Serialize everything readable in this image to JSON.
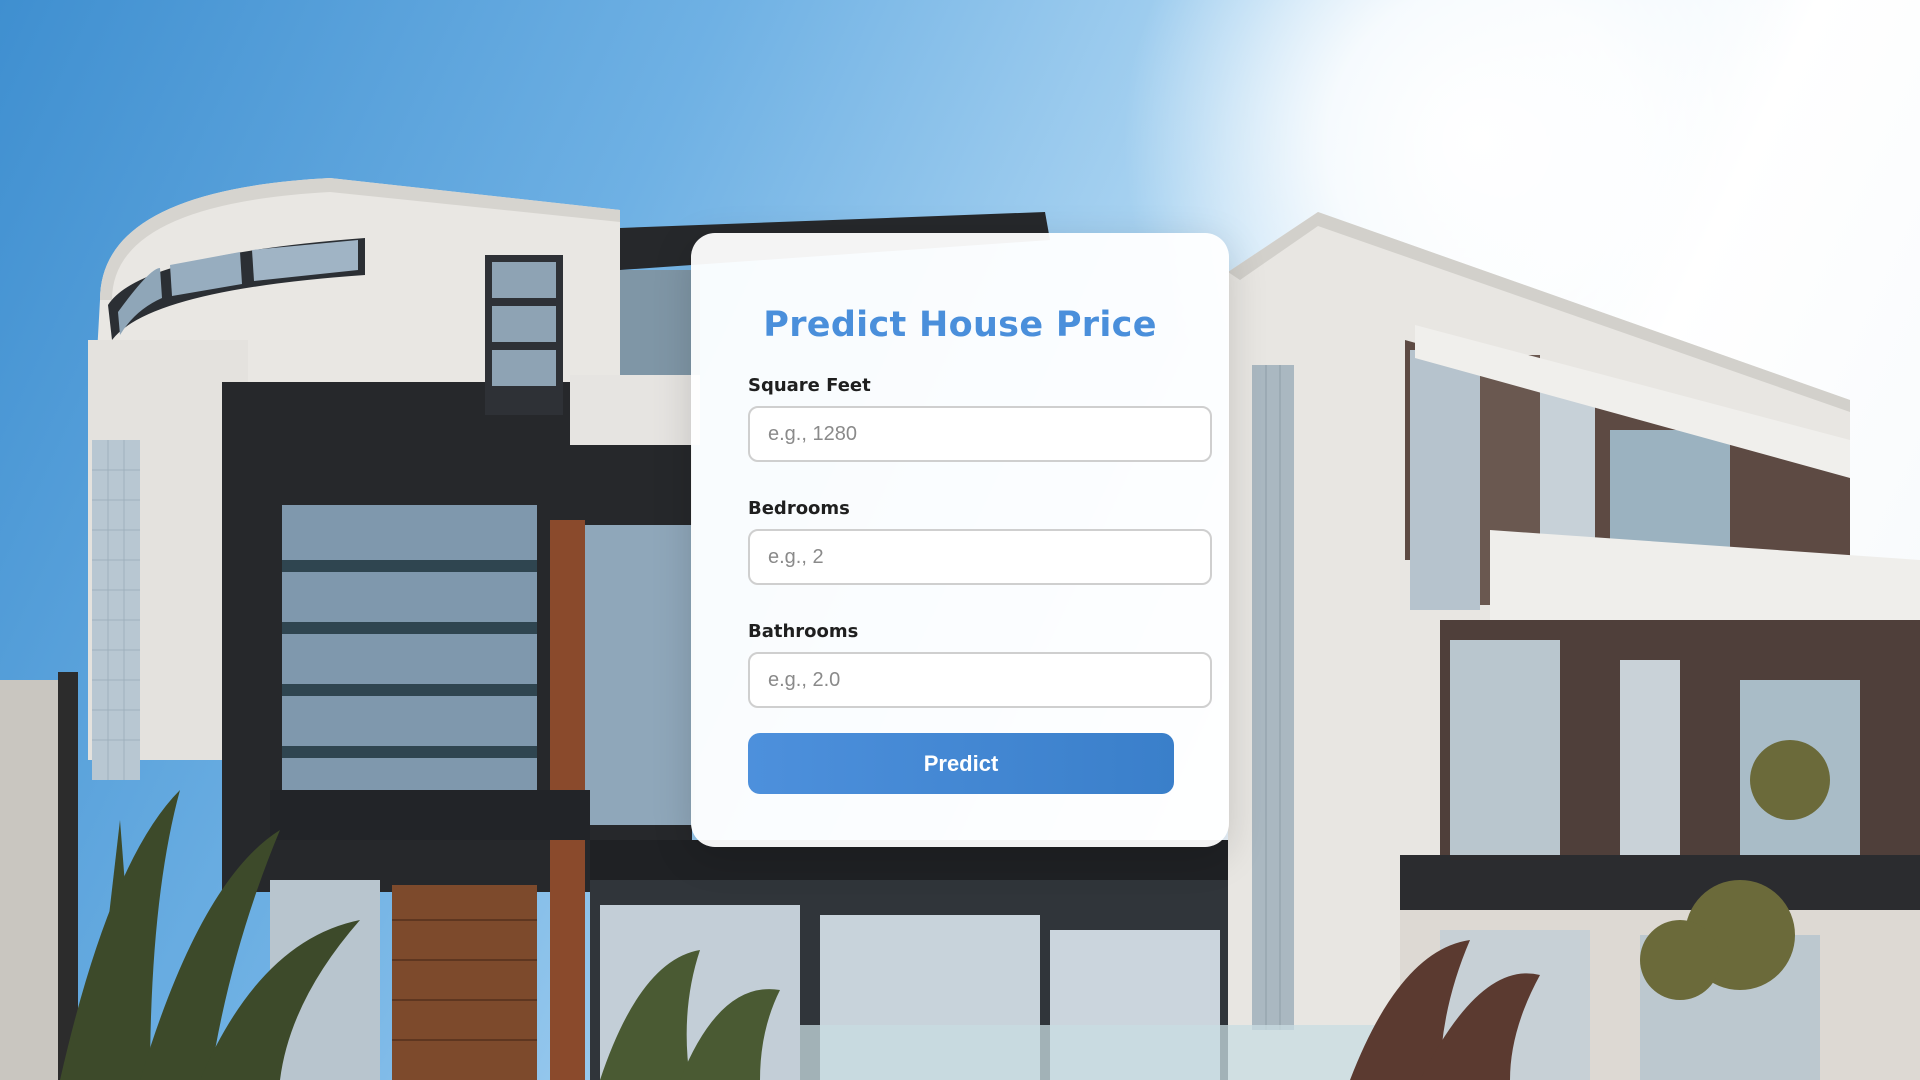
{
  "page": {
    "background": "modern-houses-photo"
  },
  "form": {
    "title": "Predict House Price",
    "fields": [
      {
        "label": "Square Feet",
        "placeholder": "e.g., 1280",
        "value": ""
      },
      {
        "label": "Bedrooms",
        "placeholder": "e.g., 2",
        "value": ""
      },
      {
        "label": "Bathrooms",
        "placeholder": "e.g., 2.0",
        "value": ""
      }
    ],
    "submit_label": "Predict"
  },
  "colors": {
    "title": "#4a8fdb",
    "button": "#4a8cd6",
    "button_text": "#ffffff",
    "card": "#ffffff"
  }
}
